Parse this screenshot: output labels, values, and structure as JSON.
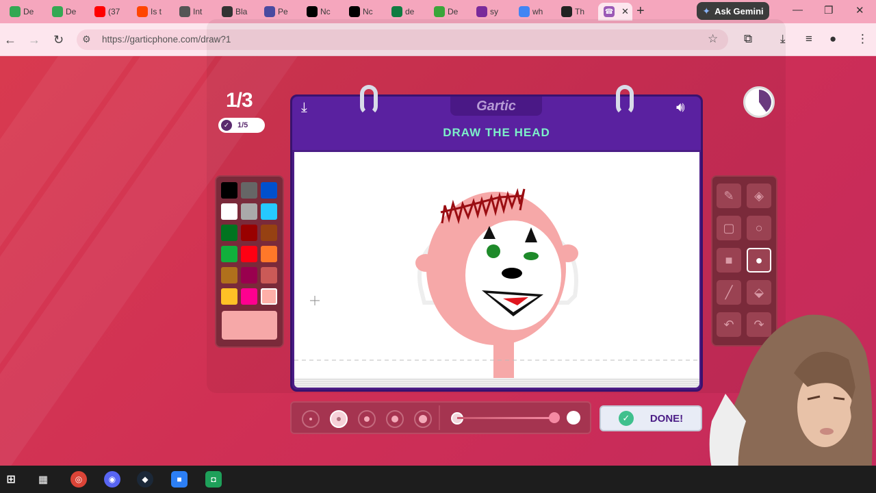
{
  "browser": {
    "tabs": [
      {
        "label": "De",
        "icon": "google-drive-icon",
        "color": "#34a853"
      },
      {
        "label": "De",
        "icon": "google-drive-icon",
        "color": "#34a853"
      },
      {
        "label": "(37",
        "icon": "youtube-icon",
        "color": "#ff0000"
      },
      {
        "label": "Is t",
        "icon": "reddit-icon",
        "color": "#ff4500"
      },
      {
        "label": "Int",
        "icon": "globe-icon",
        "color": "#555555"
      },
      {
        "label": "Bla",
        "icon": "wix-icon",
        "color": "#333333"
      },
      {
        "label": "Pe",
        "icon": "site-icon",
        "color": "#4a4aa0"
      },
      {
        "label": "Nc",
        "icon": "x-icon",
        "color": "#000000"
      },
      {
        "label": "Nc",
        "icon": "x-icon",
        "color": "#000000"
      },
      {
        "label": "de",
        "icon": "excel-icon",
        "color": "#107c41"
      },
      {
        "label": "De",
        "icon": "k-icon",
        "color": "#3aa53a"
      },
      {
        "label": "sy",
        "icon": "peace-icon",
        "color": "#7a2a9a"
      },
      {
        "label": "wh",
        "icon": "google-icon",
        "color": "#4285f4"
      },
      {
        "label": "Th",
        "icon": "terminal-icon",
        "color": "#222222"
      }
    ],
    "active_tab_icon": "garticphone-icon",
    "ask_gemini": "Ask Gemini",
    "url": "https://garticphone.com/draw?1"
  },
  "game": {
    "round": "1/3",
    "players_done": "1/5",
    "logo": "Gartic",
    "prompt": "DRAW THE HEAD",
    "done_label": "DONE!",
    "current_color": "#f6a8a8",
    "palette": [
      "#000000",
      "#666666",
      "#0050cd",
      "#ffffff",
      "#aaaaaa",
      "#26c9ff",
      "#017420",
      "#990000",
      "#964112",
      "#11b03c",
      "#ff0013",
      "#ff7829",
      "#b0701c",
      "#99004e",
      "#cb5a57",
      "#ffc126",
      "#ff008f",
      "#feafa8"
    ],
    "selected_palette_index": 17,
    "tools": [
      "pencil-icon",
      "eraser-icon",
      "rectangle-outline-icon",
      "ellipse-outline-icon",
      "rectangle-fill-icon",
      "ellipse-fill-icon",
      "line-icon",
      "bucket-icon",
      "undo-icon",
      "redo-icon"
    ],
    "selected_tool_index": 5,
    "brush_sizes": [
      1,
      2,
      3,
      4,
      5
    ],
    "selected_brush_size_index": 1,
    "opacity": 1.0
  },
  "colors": {
    "accent": "#4b1d86",
    "prompt_text": "#7df0c9",
    "background": "#d93c4e"
  }
}
